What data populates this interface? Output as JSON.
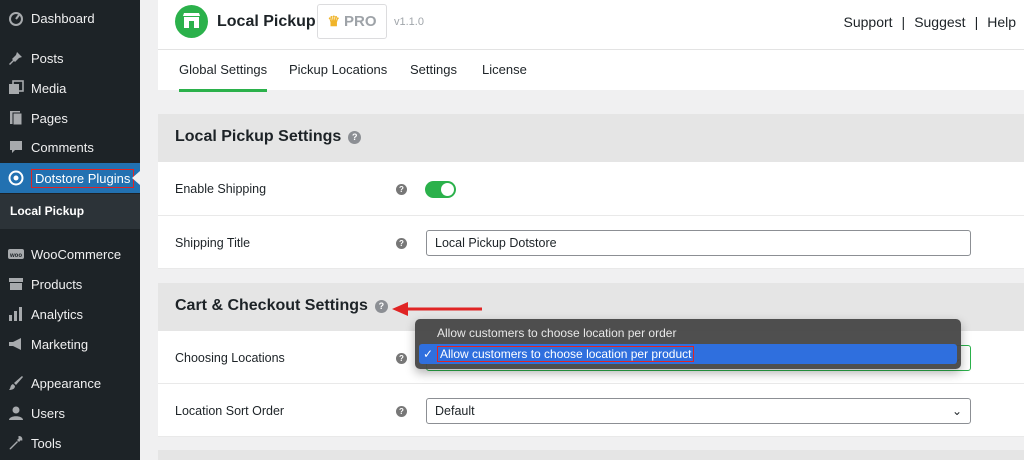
{
  "sidebar": {
    "items": [
      {
        "label": "Dashboard",
        "icon": "dashboard-icon"
      },
      {
        "label": "Posts",
        "icon": "pin-icon"
      },
      {
        "label": "Media",
        "icon": "media-icon"
      },
      {
        "label": "Pages",
        "icon": "pages-icon"
      },
      {
        "label": "Comments",
        "icon": "comment-icon"
      },
      {
        "label": "Dotstore Plugins",
        "icon": "circle-target-icon"
      },
      {
        "label": "WooCommerce",
        "icon": "woo-icon"
      },
      {
        "label": "Products",
        "icon": "archive-icon"
      },
      {
        "label": "Analytics",
        "icon": "bar-chart-icon"
      },
      {
        "label": "Marketing",
        "icon": "megaphone-icon"
      },
      {
        "label": "Appearance",
        "icon": "brush-icon"
      },
      {
        "label": "Users",
        "icon": "user-icon"
      },
      {
        "label": "Tools",
        "icon": "wrench-icon"
      }
    ],
    "submenu_label": "Local Pickup"
  },
  "header": {
    "title": "Local Pickup",
    "pro_label": "PRO",
    "version": "v1.1.0",
    "links": [
      "Support",
      "Suggest",
      "Help"
    ],
    "separator": "|"
  },
  "tabs": [
    "Global Settings",
    "Pickup Locations",
    "Settings",
    "License"
  ],
  "sections": {
    "local_pickup": {
      "title": "Local Pickup Settings",
      "enable_shipping_label": "Enable Shipping",
      "enable_shipping_on": true,
      "shipping_title_label": "Shipping Title",
      "shipping_title_value": "Local Pickup Dotstore"
    },
    "cart_checkout": {
      "title": "Cart & Checkout Settings",
      "choosing_locations_label": "Choosing Locations",
      "location_sort_label": "Location Sort Order",
      "location_sort_value": "Default"
    }
  },
  "dropdown": {
    "options": [
      "Allow customers to choose location per order",
      "Allow customers to choose location per product"
    ],
    "selected_index": 1
  },
  "colors": {
    "accent": "#2bb14b",
    "wp_blue": "#2271b1",
    "highlight_red": "#e02424",
    "select_blue": "#2f6fde"
  }
}
